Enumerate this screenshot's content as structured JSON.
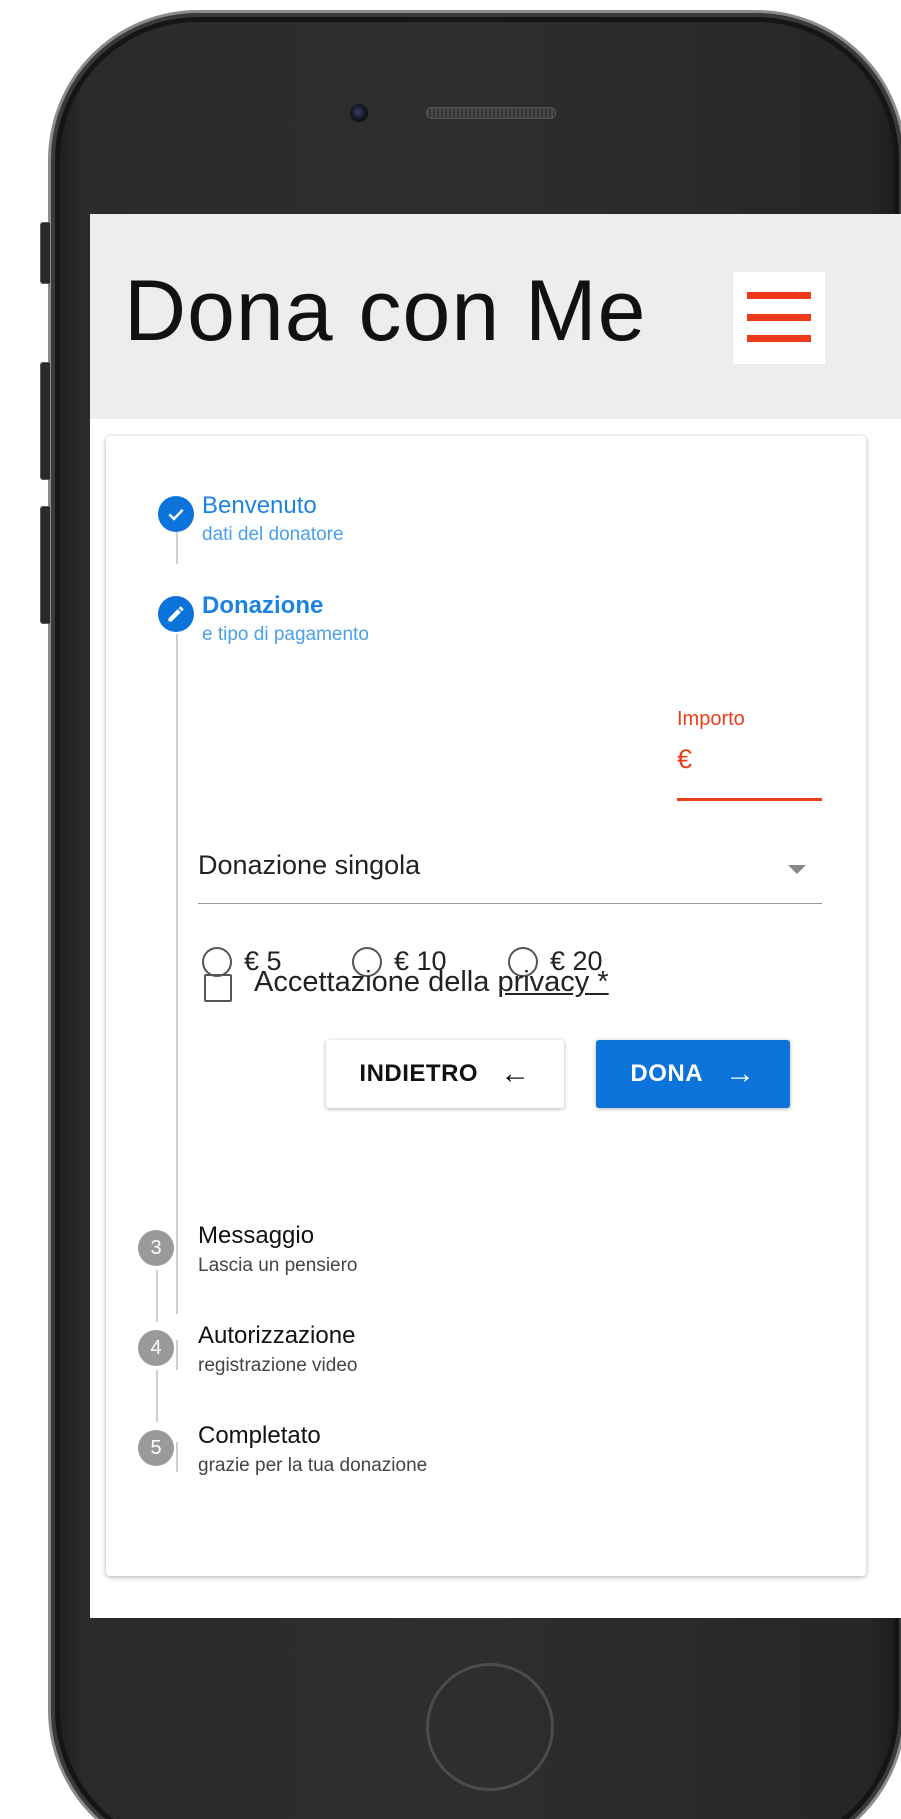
{
  "app": {
    "title": "Dona con Me",
    "brand_color": "#0b73d9",
    "accent_color": "#ee3a1a"
  },
  "steps": [
    {
      "title": "Benvenuto",
      "subtitle": "dati del donatore",
      "icon": "check-icon"
    },
    {
      "title": "Donazione",
      "subtitle": "e tipo di pagamento",
      "icon": "pencil-icon"
    },
    {
      "number": "3",
      "title": "Messaggio",
      "subtitle": "Lascia un pensiero"
    },
    {
      "number": "4",
      "title": "Autorizzazione",
      "subtitle": "registrazione video"
    },
    {
      "number": "5",
      "title": "Completato",
      "subtitle": "grazie per la tua donazione"
    }
  ],
  "donation": {
    "amounts": [
      "€ 5",
      "€ 10",
      "€ 20"
    ],
    "custom_label": "Importo",
    "custom_value": "€",
    "frequency": "Donazione singola",
    "privacy_text": "Accettazione della ",
    "privacy_link": "privacy",
    "privacy_required": " *"
  },
  "buttons": {
    "back": "INDIETRO",
    "back_icon": "←",
    "donate": "DONA",
    "donate_icon": "→"
  }
}
